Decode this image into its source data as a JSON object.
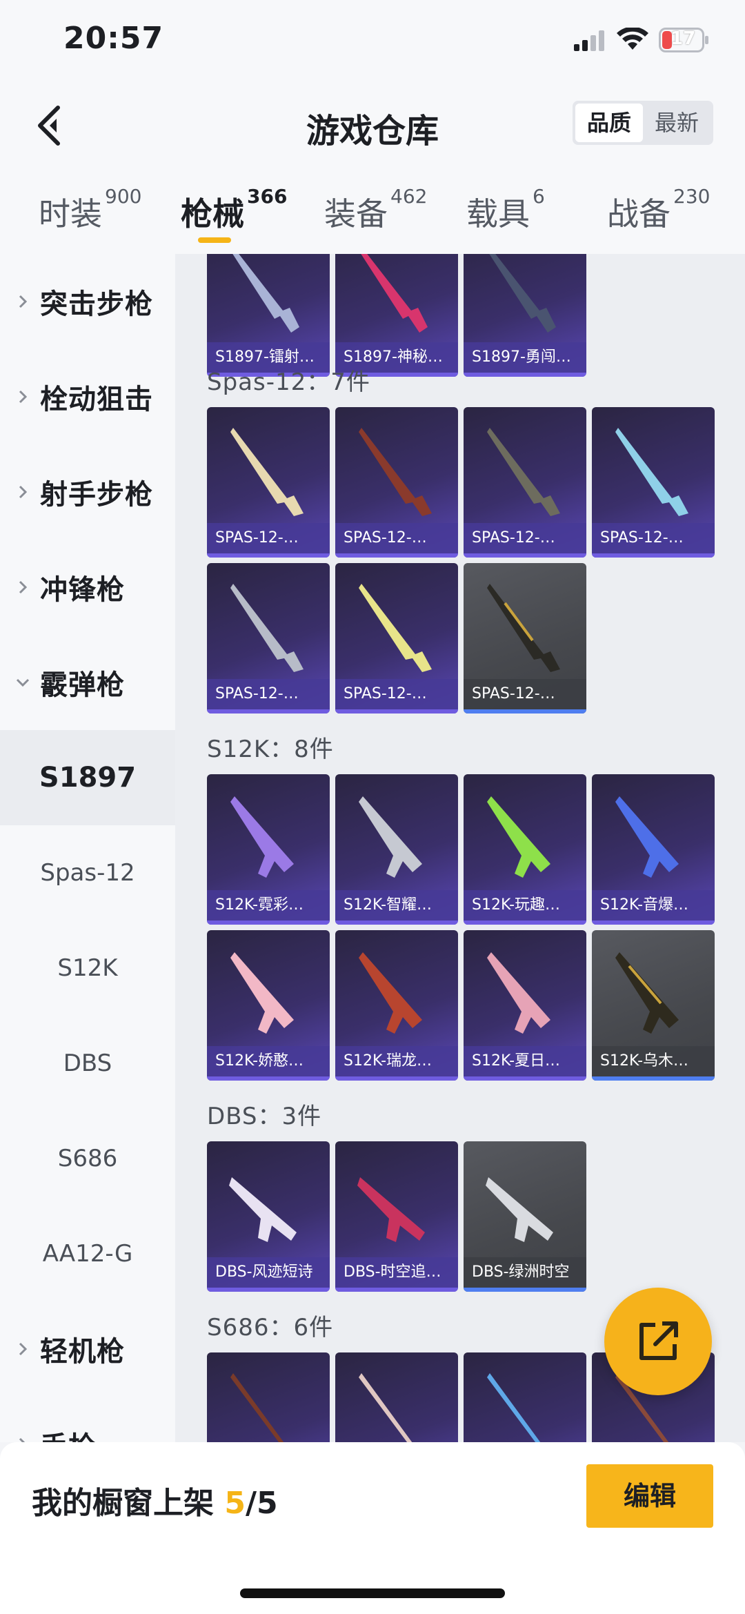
{
  "status_bar": {
    "time": "20:57",
    "battery": "17"
  },
  "header": {
    "title": "游戏仓库",
    "sort_options": [
      "品质",
      "最新"
    ]
  },
  "tabs": [
    {
      "label": "时装",
      "count": "900"
    },
    {
      "label": "枪械",
      "count": "366"
    },
    {
      "label": "装备",
      "count": "462"
    },
    {
      "label": "载具",
      "count": "6"
    },
    {
      "label": "战备",
      "count": "230"
    }
  ],
  "sidebar": {
    "categories": [
      "突击步枪",
      "栓动狙击",
      "射手步枪",
      "冲锋枪",
      "霰弹枪",
      "轻机枪",
      "手枪"
    ],
    "subitems": [
      "S1897",
      "Spas-12",
      "S12K",
      "DBS",
      "S686",
      "AA12-G"
    ]
  },
  "groups": [
    {
      "title": "",
      "items": [
        "S1897-镭射…",
        "S1897-神秘…",
        "S1897-勇闯…"
      ]
    },
    {
      "title": "Spas-12：7件",
      "items": [
        "SPAS-12-…",
        "SPAS-12-…",
        "SPAS-12-…",
        "SPAS-12-…",
        "SPAS-12-…",
        "SPAS-12-…",
        "SPAS-12-…"
      ]
    },
    {
      "title": "S12K：8件",
      "items": [
        "S12K-霓彩…",
        "S12K-智耀…",
        "S12K-玩趣…",
        "S12K-音爆…",
        "S12K-娇憨…",
        "S12K-瑞龙…",
        "S12K-夏日…",
        "S12K-乌木…"
      ]
    },
    {
      "title": "DBS：3件",
      "items": [
        "DBS-风迹短诗",
        "DBS-时空追…",
        "DBS-绿洲时空"
      ]
    },
    {
      "title": "S686：6件",
      "items": [
        "",
        "",
        "",
        ""
      ]
    }
  ],
  "bottom": {
    "label": "我的橱窗上架",
    "count": "5",
    "total": "/5",
    "edit": "编辑"
  },
  "colors": {
    "accent": "#f5b417",
    "card_purple": "#3a2f6a",
    "card_gray": "#4a4c51"
  }
}
